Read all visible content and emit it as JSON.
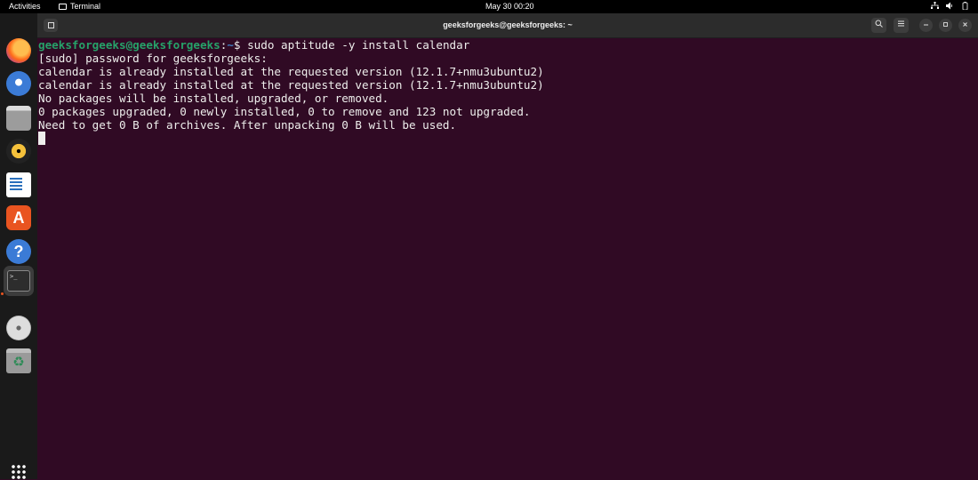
{
  "topbar": {
    "activities": "Activities",
    "app_name": "Terminal",
    "clock": "May 30  00:20"
  },
  "dock": {
    "items": [
      {
        "icon": "firefox-icon"
      },
      {
        "icon": "thunderbird-icon"
      },
      {
        "icon": "files-icon"
      },
      {
        "icon": "rhythmbox-icon"
      },
      {
        "icon": "libreoffice-writer-icon"
      },
      {
        "icon": "ubuntu-software-icon"
      },
      {
        "icon": "help-icon"
      },
      {
        "icon": "terminal-icon",
        "active": true
      },
      {
        "icon": "dvd-icon"
      },
      {
        "icon": "trash-icon"
      },
      {
        "icon": "show-apps-icon"
      }
    ],
    "accent": "#e95420"
  },
  "window": {
    "title": "geeksforgeeks@geeksforgeeks: ~"
  },
  "terminal": {
    "prompt_user": "geeksforgeeks@geeksforgeeks",
    "prompt_path": "~",
    "prompt_sep1": ":",
    "prompt_symbol": "$",
    "command": " sudo aptitude -y install calendar",
    "lines": [
      "[sudo] password for geeksforgeeks:",
      "calendar is already installed at the requested version (12.1.7+nmu3ubuntu2)",
      "calendar is already installed at the requested version (12.1.7+nmu3ubuntu2)",
      "No packages will be installed, upgraded, or removed.",
      "0 packages upgraded, 0 newly installed, 0 to remove and 123 not upgraded.",
      "Need to get 0 B of archives. After unpacking 0 B will be used."
    ],
    "colors": {
      "background": "#300a24",
      "user": "#26a269",
      "path": "#3f7ec1",
      "text": "#eeeeec"
    }
  }
}
